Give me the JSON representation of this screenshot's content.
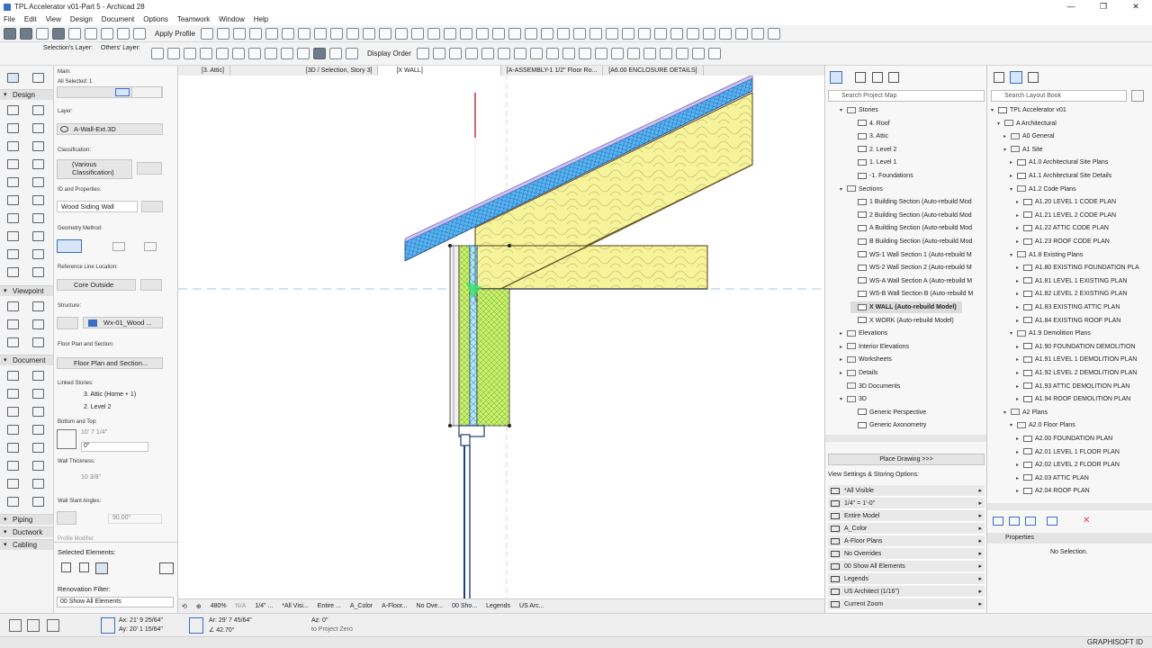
{
  "window": {
    "title": "TPL Accelerator v01-Part 5 - Archicad 28",
    "controls": [
      "—",
      "❐",
      "✕"
    ]
  },
  "menu": [
    "File",
    "Edit",
    "View",
    "Design",
    "Document",
    "Options",
    "Teamwork",
    "Window",
    "Help"
  ],
  "toolbar1": {
    "apply_profile": "Apply Profile"
  },
  "toolbar2": {
    "selections_layer": "Selection's Layer:",
    "others_layer": "Others' Layer:",
    "display_order": "Display Order"
  },
  "toolbox": {
    "main_label": "Main:",
    "sections": [
      "Design",
      "Viewpoint",
      "Document",
      "Piping",
      "Ductwork",
      "Cabling"
    ]
  },
  "infobox": {
    "all_selected": "All Selected: 1",
    "layer_label": "Layer:",
    "layer_value": "A-Wall-Ext.3D",
    "classification_label": "Classification:",
    "classification_value": "(Various Classification)",
    "id_label": "ID and Properties:",
    "id_value": "Wood Siding Wall",
    "geometry_label": "Geometry Method:",
    "refline_label": "Reference Line Location:",
    "refline_value": "Core Outside",
    "structure_label": "Structure:",
    "structure_value": "Wx-01_Wood ...",
    "floorplan_label": "Floor Plan and Section:",
    "floorplan_value": "Floor Plan and Section...",
    "linked_label": "Linked Stories:",
    "linked_top": "3. Attic (Home + 1)",
    "linked_bottom": "2. Level 2",
    "bottom_top_label": "Bottom and Top:",
    "bottom_top_1": "10' 7 1/4\"",
    "bottom_top_2": "0\"",
    "thickness_label": "Wall Thickness:",
    "thickness_value": "10 3/8\"",
    "slant_label": "Wall Slant Angles:",
    "slant_value": "90.00°",
    "profile_label": "Profile Modifier:",
    "selected_elements": "Selected Elements:",
    "renovation_label": "Renovation Filter:",
    "renovation_value": "00 Show All Elements"
  },
  "tabs": [
    "[3. Attic]",
    "[3D / Selection, Story 3]",
    "[X WALL]",
    "[A-ASSEMBLY-1 1/2\" Floor Ro...",
    "[A6.00 ENCLOSURE DETAILS]"
  ],
  "project_map": {
    "search_placeholder": "Search Project Map",
    "items": [
      {
        "label": "Stories",
        "indent": 1,
        "caret": "▾",
        "folder": true
      },
      {
        "label": "4. Roof",
        "indent": 2
      },
      {
        "label": "3. Attic",
        "indent": 2
      },
      {
        "label": "2. Level 2",
        "indent": 2
      },
      {
        "label": "1. Level 1",
        "indent": 2
      },
      {
        "label": "-1. Foundations",
        "indent": 2
      },
      {
        "label": "Sections",
        "indent": 1,
        "caret": "▾",
        "folder": true
      },
      {
        "label": "1 Building Section (Auto-rebuild Mod",
        "indent": 2
      },
      {
        "label": "2 Building Section (Auto-rebuild Mod",
        "indent": 2
      },
      {
        "label": "A Building Section (Auto-rebuild Mod",
        "indent": 2
      },
      {
        "label": "B Building Section (Auto-rebuild Mod",
        "indent": 2
      },
      {
        "label": "WS-1 Wall Section 1 (Auto-rebuild M",
        "indent": 2
      },
      {
        "label": "WS-2 Wall Section 2 (Auto-rebuild M",
        "indent": 2
      },
      {
        "label": "WS-A Wall Section A (Auto-rebuild M",
        "indent": 2
      },
      {
        "label": "WS-B Wall Section B (Auto-rebuild M",
        "indent": 2
      },
      {
        "label": "X WALL (Auto-rebuild Model)",
        "indent": 2,
        "selected": true
      },
      {
        "label": "X WORK (Auto-rebuild Model)",
        "indent": 2
      },
      {
        "label": "Elevations",
        "indent": 1,
        "caret": "▸",
        "folder": true
      },
      {
        "label": "Interior Elevations",
        "indent": 1,
        "caret": "▸",
        "folder": true
      },
      {
        "label": "Worksheets",
        "indent": 1,
        "caret": "▸",
        "folder": true
      },
      {
        "label": "Details",
        "indent": 1,
        "caret": "▸",
        "folder": true
      },
      {
        "label": "3D Documents",
        "indent": 1,
        "folder": true
      },
      {
        "label": "3D",
        "indent": 1,
        "caret": "▾",
        "folder": true
      },
      {
        "label": "Generic Perspective",
        "indent": 2
      },
      {
        "label": "Generic Axonometry",
        "indent": 2
      }
    ],
    "place_drawing": "Place Drawing >>>",
    "view_settings_label": "View Settings & Storing Options:",
    "view_settings": [
      "*All Visible",
      "1/4\"  =  1'-0\"",
      "Entire Model",
      "A_Color",
      "A-Floor Plans",
      "No Overrides",
      "00 Show All Elements",
      "Legends",
      "US Architect (1/16\")",
      "Current Zoom"
    ]
  },
  "layout_book": {
    "search_placeholder": "Search Layout Book",
    "items": [
      {
        "label": "TPL Accelerator v01",
        "indent": 0,
        "caret": "▾"
      },
      {
        "label": "A Architectural",
        "indent": 1,
        "caret": "▾",
        "folder": true
      },
      {
        "label": "A0 General",
        "indent": 2,
        "caret": "▸",
        "folder": true
      },
      {
        "label": "A1 Site",
        "indent": 2,
        "caret": "▾",
        "folder": true
      },
      {
        "label": "A1.0 Architectural Site Plans",
        "indent": 3,
        "caret": "▸"
      },
      {
        "label": "A1.1 Architectural Site Details",
        "indent": 3,
        "caret": "▸"
      },
      {
        "label": "A1.2 Code Plans",
        "indent": 3,
        "caret": "▾",
        "folder": true
      },
      {
        "label": "A1.20 LEVEL 1 CODE PLAN",
        "indent": 4,
        "caret": "▸"
      },
      {
        "label": "A1.21 LEVEL 2 CODE PLAN",
        "indent": 4,
        "caret": "▸"
      },
      {
        "label": "A1.22 ATTIC CODE PLAN",
        "indent": 4,
        "caret": "▸"
      },
      {
        "label": "A1.23 ROOF CODE PLAN",
        "indent": 4,
        "caret": "▸"
      },
      {
        "label": "A1.8 Existing Plans",
        "indent": 3,
        "caret": "▾",
        "folder": true
      },
      {
        "label": "A1.80 EXISTING FOUNDATION PLA",
        "indent": 4,
        "caret": "▸"
      },
      {
        "label": "A1.81 LEVEL 1 EXISTING PLAN",
        "indent": 4,
        "caret": "▸"
      },
      {
        "label": "A1.82 LEVEL 2 EXISTING PLAN",
        "indent": 4,
        "caret": "▸"
      },
      {
        "label": "A1.83 EXISTING ATTIC PLAN",
        "indent": 4,
        "caret": "▸"
      },
      {
        "label": "A1.84 EXISTING ROOF PLAN",
        "indent": 4,
        "caret": "▸"
      },
      {
        "label": "A1.9 Demolition Plans",
        "indent": 3,
        "caret": "▾",
        "folder": true
      },
      {
        "label": "A1.90 FOUNDATION DEMOLITION",
        "indent": 4,
        "caret": "▸"
      },
      {
        "label": "A1.91 LEVEL 1 DEMOLITION PLAN",
        "indent": 4,
        "caret": "▸"
      },
      {
        "label": "A1.92 LEVEL 2 DEMOLITION PLAN",
        "indent": 4,
        "caret": "▸"
      },
      {
        "label": "A1.93 ATTIC DEMOLITION PLAN",
        "indent": 4,
        "caret": "▸"
      },
      {
        "label": "A1.94 ROOF DEMOLITION PLAN",
        "indent": 4,
        "caret": "▸"
      },
      {
        "label": "A2 Plans",
        "indent": 2,
        "caret": "▾",
        "folder": true
      },
      {
        "label": "A2.0 Floor Plans",
        "indent": 3,
        "caret": "▾",
        "folder": true
      },
      {
        "label": "A2.00 FOUNDATION PLAN",
        "indent": 4,
        "caret": "▸"
      },
      {
        "label": "A2.01 LEVEL 1 FLOOR PLAN",
        "indent": 4,
        "caret": "▸"
      },
      {
        "label": "A2.02 LEVEL 2 FLOOR PLAN",
        "indent": 4,
        "caret": "▸"
      },
      {
        "label": "A2.03 ATTIC PLAN",
        "indent": 4,
        "caret": "▸"
      },
      {
        "label": "A2.04 ROOF PLAN",
        "indent": 4,
        "caret": "▸"
      }
    ],
    "properties_label": "Properties",
    "no_selection": "No Selection."
  },
  "bottom_bar": {
    "zoom": "480%",
    "na": "N/A",
    "scale": "1/4\" ...",
    "layers": "*All Visi...",
    "model": "Entire ...",
    "pen": "A_Color",
    "floor": "A-Floor...",
    "override": "No Ove...",
    "renovation": "00 Sho...",
    "legends": "Legends",
    "dim": "US Arc..."
  },
  "status": {
    "ax": "Ax: 21' 9 25/64\"",
    "ay": "Ay: 20' 1 15/64\"",
    "ar": "Ar: 29' 7 45/64\"",
    "angle": "∠ 42.70°",
    "az": "Az: 0\"",
    "to_zero": "to Project Zero",
    "brand": "GRAPHISOFT ID"
  }
}
